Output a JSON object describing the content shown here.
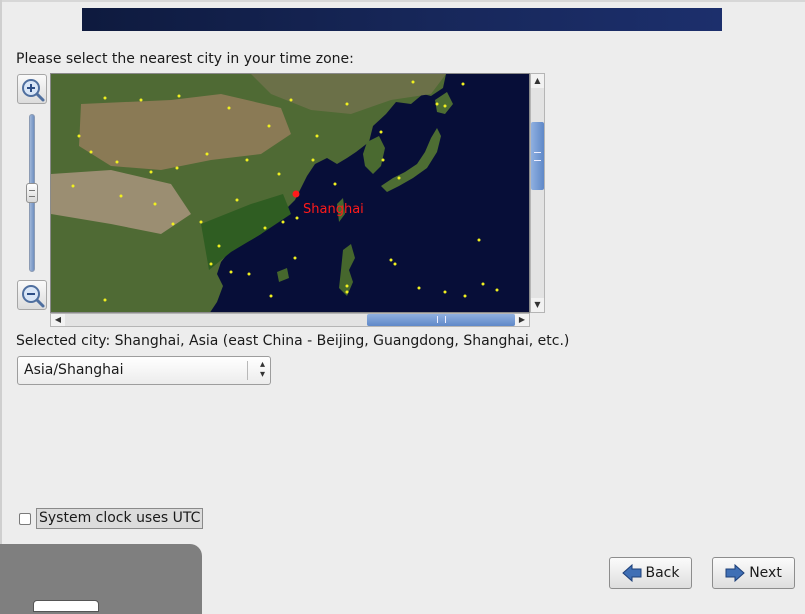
{
  "header": {
    "banner_color": "#17275a"
  },
  "timezone": {
    "prompt": "Please select the nearest city in your time zone:",
    "selected_city_text": "Selected city: Shanghai, Asia (east China - Beijing, Guangdong, Shanghai, etc.)",
    "combo_value": "Asia/Shanghai"
  },
  "map": {
    "marker_label": "Shanghai",
    "marker_color": "#ff1a1a",
    "city_dot_color": "#f0f020",
    "ocean_color": "#070e38"
  },
  "controls": {
    "zoom_in_icon": "zoom-in-magnifier-icon",
    "zoom_out_icon": "zoom-out-magnifier-icon"
  },
  "options": {
    "utc_label": "System clock uses UTC",
    "utc_checked": false
  },
  "buttons": {
    "back_label": "Back",
    "next_label": "Next"
  }
}
